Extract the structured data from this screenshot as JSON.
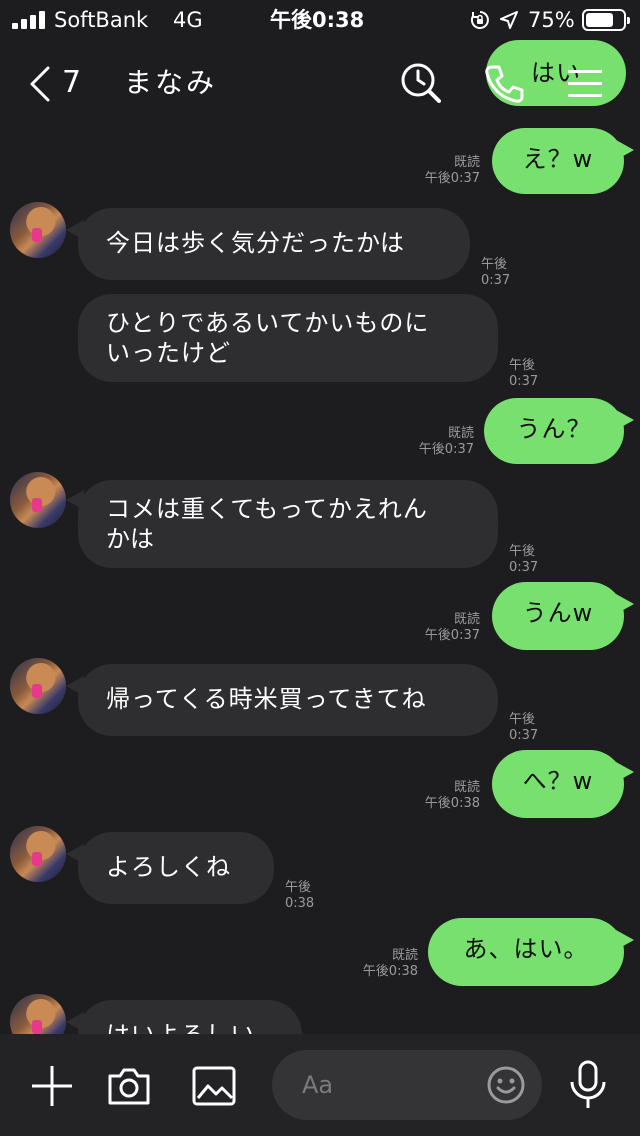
{
  "status_bar": {
    "carrier": "SoftBank",
    "network": "4G",
    "time": "午後0:38",
    "battery_percent": "75%",
    "battery_level": 0.75
  },
  "header": {
    "back_count": "7",
    "contact_name": "まなみ",
    "peek_bubble_text": "はい"
  },
  "messages": [
    {
      "side": "out",
      "text": "え？w",
      "read": "既読",
      "time": "午後0:37"
    },
    {
      "side": "in",
      "lines": [
        "今日は歩く気分だったかは"
      ],
      "time": "午後0:37",
      "avatar": true
    },
    {
      "side": "in",
      "lines": [
        "ひとりであるいてかいものに",
        "いったけど"
      ],
      "time": "午後0:37",
      "avatar": false
    },
    {
      "side": "out",
      "text": "うん？",
      "read": "既読",
      "time": "午後0:37"
    },
    {
      "side": "in",
      "lines": [
        "コメは重くてもってかえれん",
        "かは"
      ],
      "time": "午後0:37",
      "avatar": true
    },
    {
      "side": "out",
      "text": "うんw",
      "read": "既読",
      "time": "午後0:37"
    },
    {
      "side": "in",
      "lines": [
        "帰ってくる時米買ってきてね"
      ],
      "time": "午後0:37",
      "avatar": true
    },
    {
      "side": "out",
      "text": "へ？w",
      "read": "既読",
      "time": "午後0:38"
    },
    {
      "side": "in",
      "lines": [
        "よろしくね"
      ],
      "time": "午後0:38",
      "avatar": true
    },
    {
      "side": "out",
      "text": "あ、はい。",
      "read": "既読",
      "time": "午後0:38"
    },
    {
      "side": "in",
      "lines": [
        "はいよろしい"
      ],
      "time": "",
      "avatar": true
    }
  ],
  "input_bar": {
    "placeholder": "Aa"
  },
  "colors": {
    "background": "#1d1d1f",
    "outgoing_bubble": "#78e06f",
    "incoming_bubble": "#2e2e30",
    "meta_text": "#9a9a9a"
  },
  "icons": [
    "back-chevron-icon",
    "search-clock-icon",
    "phone-icon",
    "menu-icon",
    "plus-icon",
    "camera-icon",
    "image-icon",
    "emoji-icon",
    "microphone-icon",
    "location-arrow-icon",
    "rotation-lock-icon",
    "signal-icon",
    "battery-icon"
  ]
}
